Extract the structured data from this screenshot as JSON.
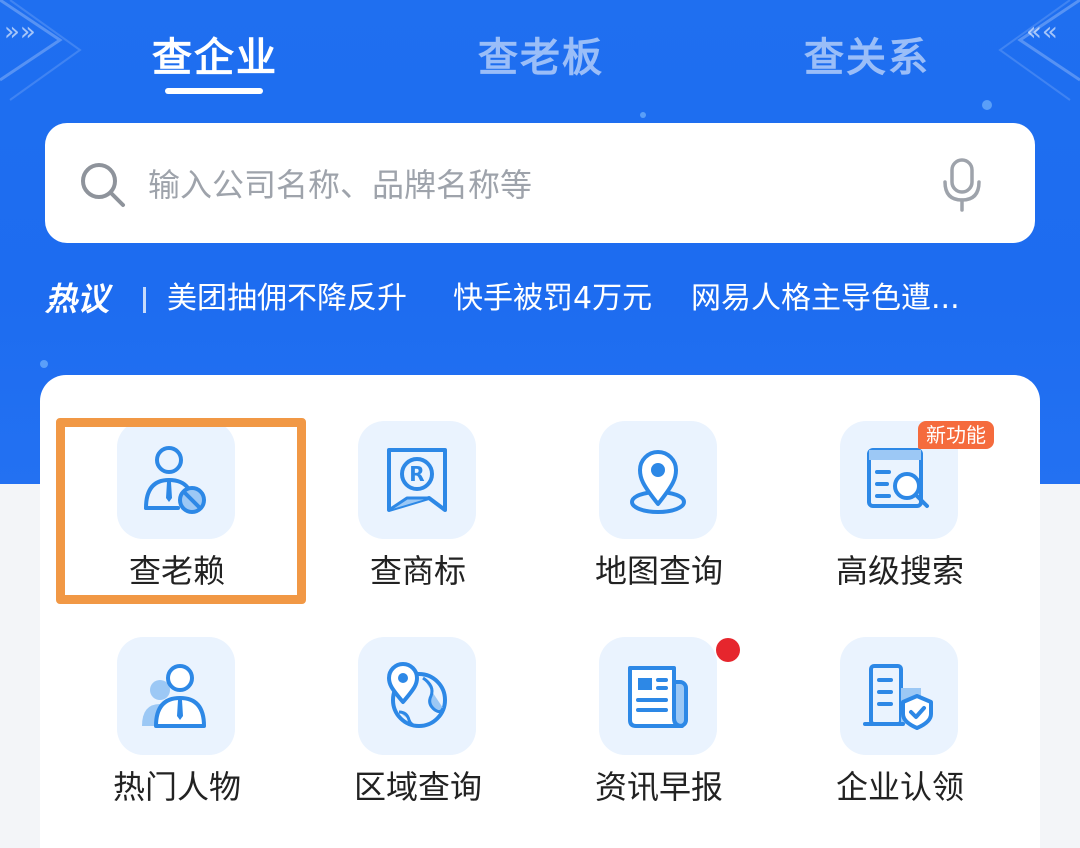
{
  "tabs": [
    {
      "label": "查企业",
      "active": true
    },
    {
      "label": "查老板",
      "active": false
    },
    {
      "label": "查关系",
      "active": false
    }
  ],
  "search": {
    "placeholder": "输入公司名称、品牌名称等",
    "icon": "search-icon",
    "voice_icon": "microphone-icon"
  },
  "hot": {
    "title": "热议",
    "items": [
      "美团抽佣不降反升",
      "快手被罚4万元",
      "网易人格主导色遭..."
    ]
  },
  "features": [
    {
      "label": "查老赖",
      "icon": "person-ban-icon"
    },
    {
      "label": "查商标",
      "icon": "trademark-icon"
    },
    {
      "label": "地图查询",
      "icon": "map-pin-icon"
    },
    {
      "label": "高级搜索",
      "icon": "advanced-search-icon",
      "badge": "新功能"
    },
    {
      "label": "热门人物",
      "icon": "people-icon"
    },
    {
      "label": "区域查询",
      "icon": "globe-pin-icon"
    },
    {
      "label": "资讯早报",
      "icon": "newspaper-icon",
      "dot": true
    },
    {
      "label": "企业认领",
      "icon": "building-shield-icon"
    }
  ],
  "colors": {
    "brand_blue": "#1f6ff0",
    "icon_blue": "#2d88e6",
    "tile_bg": "#eaf3fe",
    "badge_bg": "#f56b3d",
    "dot_red": "#e6262d",
    "highlight_orange": "#f19845"
  }
}
